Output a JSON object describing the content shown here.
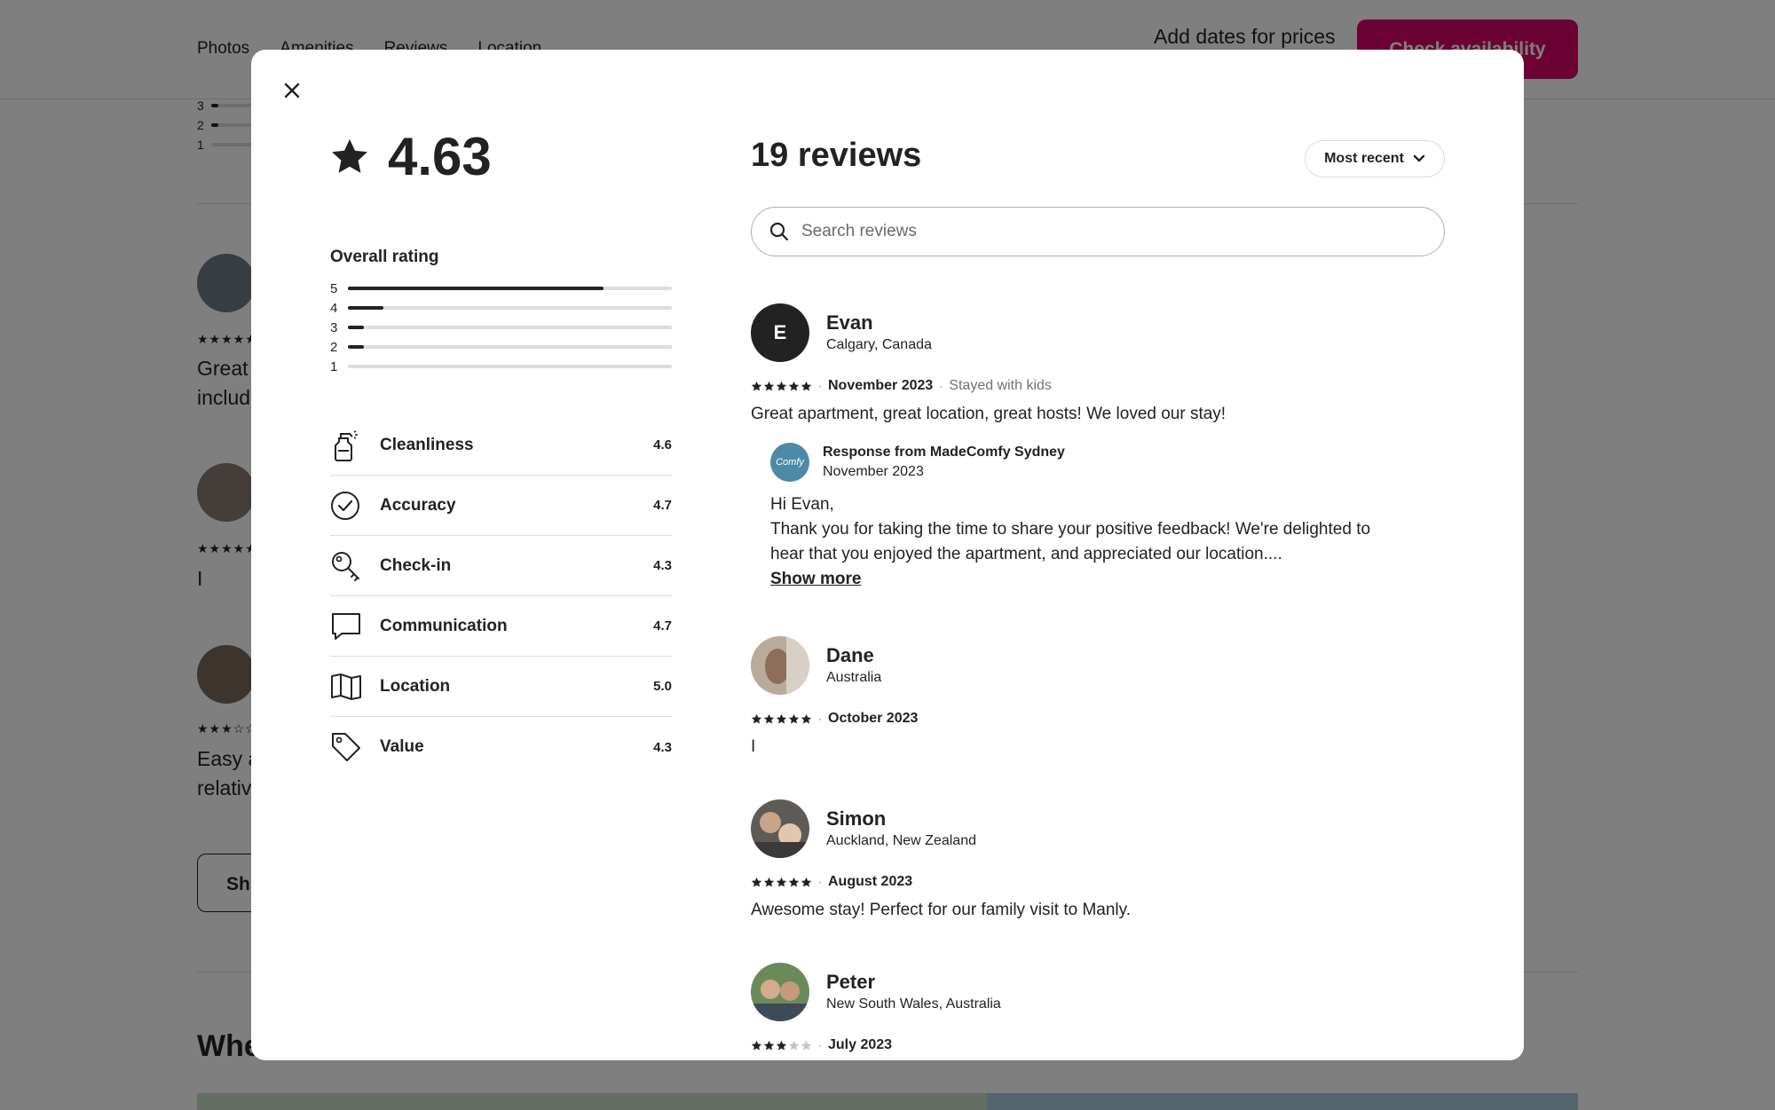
{
  "background": {
    "nav_links": [
      "Photos",
      "Amenities",
      "Reviews",
      "Location"
    ],
    "dates_prompt": "Add dates for prices",
    "check_availability": "Check availability",
    "hist_labels": [
      "3",
      "2",
      "1"
    ],
    "snippets": [
      "Great",
      "includ",
      "I",
      "Easy a",
      "relativ"
    ],
    "show_btn": "Sh",
    "where_heading": "Whe"
  },
  "modal": {
    "close_icon": "close-icon",
    "overall_score": "4.63",
    "overall_label": "Overall rating",
    "histogram": [
      {
        "stars": "5",
        "fraction": 0.79
      },
      {
        "stars": "4",
        "fraction": 0.11
      },
      {
        "stars": "3",
        "fraction": 0.05
      },
      {
        "stars": "2",
        "fraction": 0.05
      },
      {
        "stars": "1",
        "fraction": 0.0
      }
    ],
    "categories": [
      {
        "label": "Cleanliness",
        "score": "4.6",
        "icon": "spray-bottle-icon"
      },
      {
        "label": "Accuracy",
        "score": "4.7",
        "icon": "check-circle-icon"
      },
      {
        "label": "Check-in",
        "score": "4.3",
        "icon": "key-icon"
      },
      {
        "label": "Communication",
        "score": "4.7",
        "icon": "message-icon"
      },
      {
        "label": "Location",
        "score": "5.0",
        "icon": "map-icon"
      },
      {
        "label": "Value",
        "score": "4.3",
        "icon": "tag-icon"
      }
    ],
    "review_count": "19 reviews",
    "sort_label": "Most recent",
    "search_placeholder": "Search reviews",
    "reviews": [
      {
        "initial": "E",
        "name": "Evan",
        "location": "Calgary, Canada",
        "stars": 5,
        "date": "November 2023",
        "extra": "Stayed with kids",
        "text": "Great apartment, great location, great hosts! We loved our stay!",
        "response": {
          "logo_text": "Comfy",
          "title": "Response from MadeComfy Sydney",
          "date": "November 2023",
          "body_line1": "Hi Evan,",
          "body_line2": "Thank you for taking the time to share your positive feedback! We're delighted to",
          "body_line3": "hear that you enjoyed the apartment, and appreciated our location....",
          "show_more": "Show more"
        }
      },
      {
        "name": "Dane",
        "location": "Australia",
        "stars": 5,
        "date": "October 2023",
        "text": "I"
      },
      {
        "name": "Simon",
        "location": "Auckland, New Zealand",
        "stars": 5,
        "date": "August 2023",
        "text": "Awesome stay! Perfect for our family visit to Manly."
      },
      {
        "name": "Peter",
        "location": "New South Wales, Australia",
        "stars": 3,
        "date": "July 2023",
        "text": ""
      }
    ],
    "colors": {
      "brand": "#d70466",
      "text": "#222222",
      "muted": "#717171",
      "divider": "#dddddd"
    }
  }
}
